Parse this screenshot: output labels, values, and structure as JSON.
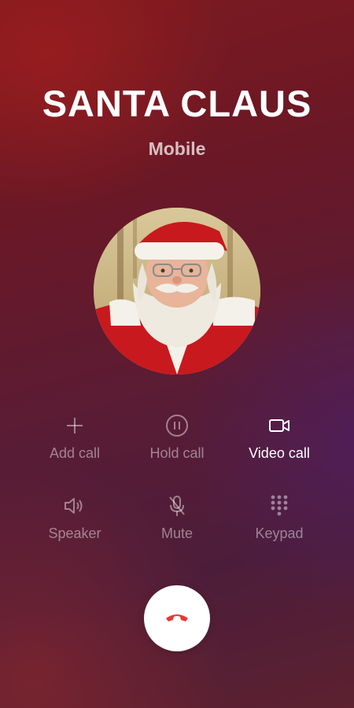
{
  "caller": {
    "name": "SANTA CLAUS",
    "type": "Mobile"
  },
  "controls": [
    {
      "label": "Add call",
      "icon": "plus-icon",
      "active": false
    },
    {
      "label": "Hold call",
      "icon": "pause-icon",
      "active": false
    },
    {
      "label": "Video call",
      "icon": "video-camera-icon",
      "active": true
    },
    {
      "label": "Speaker",
      "icon": "speaker-icon",
      "active": false
    },
    {
      "label": "Mute",
      "icon": "microphone-off-icon",
      "active": false
    },
    {
      "label": "Keypad",
      "icon": "keypad-icon",
      "active": false
    }
  ],
  "end_call": {
    "icon": "end-call-icon",
    "color": "#e53935"
  },
  "colors": {
    "background_top": "#7e1a1f",
    "background_bottom": "#4c1d3a",
    "active_label": "#ffffff"
  }
}
